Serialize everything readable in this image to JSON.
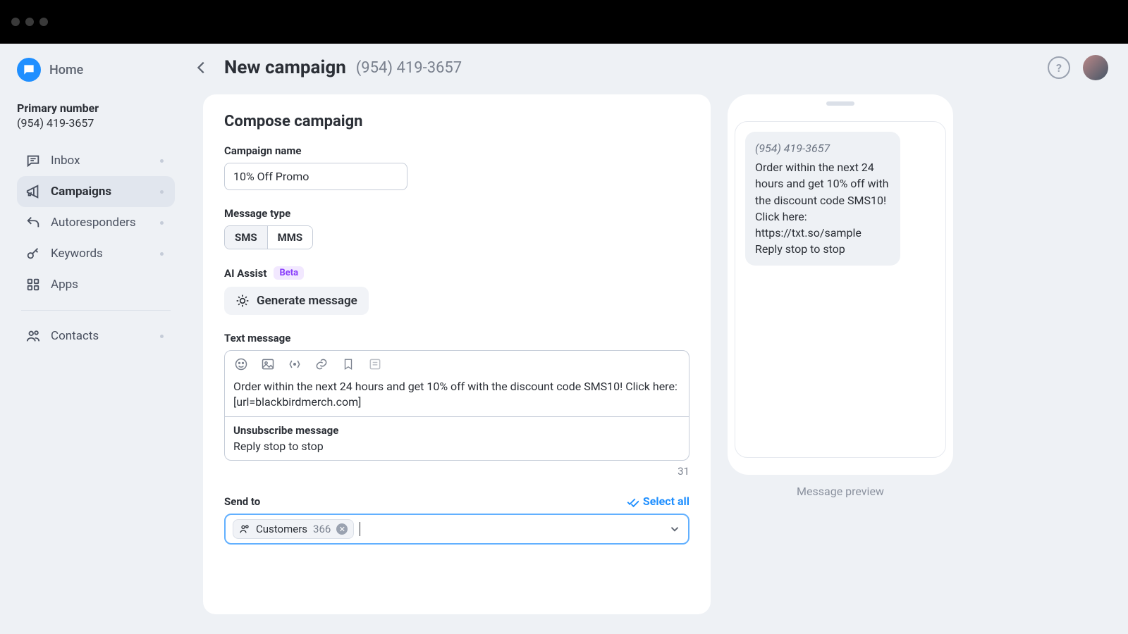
{
  "titlebar": {
    "dots": 3
  },
  "sidebar": {
    "home_label": "Home",
    "primary_label": "Primary number",
    "primary_number": "(954) 419-3657",
    "items": [
      {
        "label": "Inbox",
        "icon": "chat-icon",
        "dot": true
      },
      {
        "label": "Campaigns",
        "icon": "megaphone-icon",
        "active": true,
        "dot": true
      },
      {
        "label": "Autoresponders",
        "icon": "reply-icon",
        "dot": true
      },
      {
        "label": "Keywords",
        "icon": "key-icon",
        "dot": true
      },
      {
        "label": "Apps",
        "icon": "apps-icon",
        "dot": false
      }
    ],
    "contacts_label": "Contacts"
  },
  "header": {
    "title": "New campaign",
    "phone": "(954) 419-3657"
  },
  "compose": {
    "title": "Compose campaign",
    "name_label": "Campaign name",
    "name_value": "10% Off Promo",
    "type_label": "Message type",
    "type_options": [
      "SMS",
      "MMS"
    ],
    "type_selected": "SMS",
    "ai_label": "AI Assist",
    "ai_badge": "Beta",
    "generate_label": "Generate message",
    "text_label": "Text message",
    "text_value": "Order within the next 24 hours and get 10% off with the discount code SMS10! Click here: [url=blackbirdmerch.com]",
    "unsub_label": "Unsubscribe message",
    "unsub_value": "Reply stop to stop",
    "char_count": "31",
    "sendto_label": "Send to",
    "select_all_label": "Select all",
    "chip_name": "Customers",
    "chip_count": "366"
  },
  "preview": {
    "from": "(954) 419-3657",
    "body": "Order within the next 24 hours and get 10% off with the discount code SMS10! Click here: https://txt.so/sample Reply stop to stop",
    "caption": "Message preview"
  }
}
